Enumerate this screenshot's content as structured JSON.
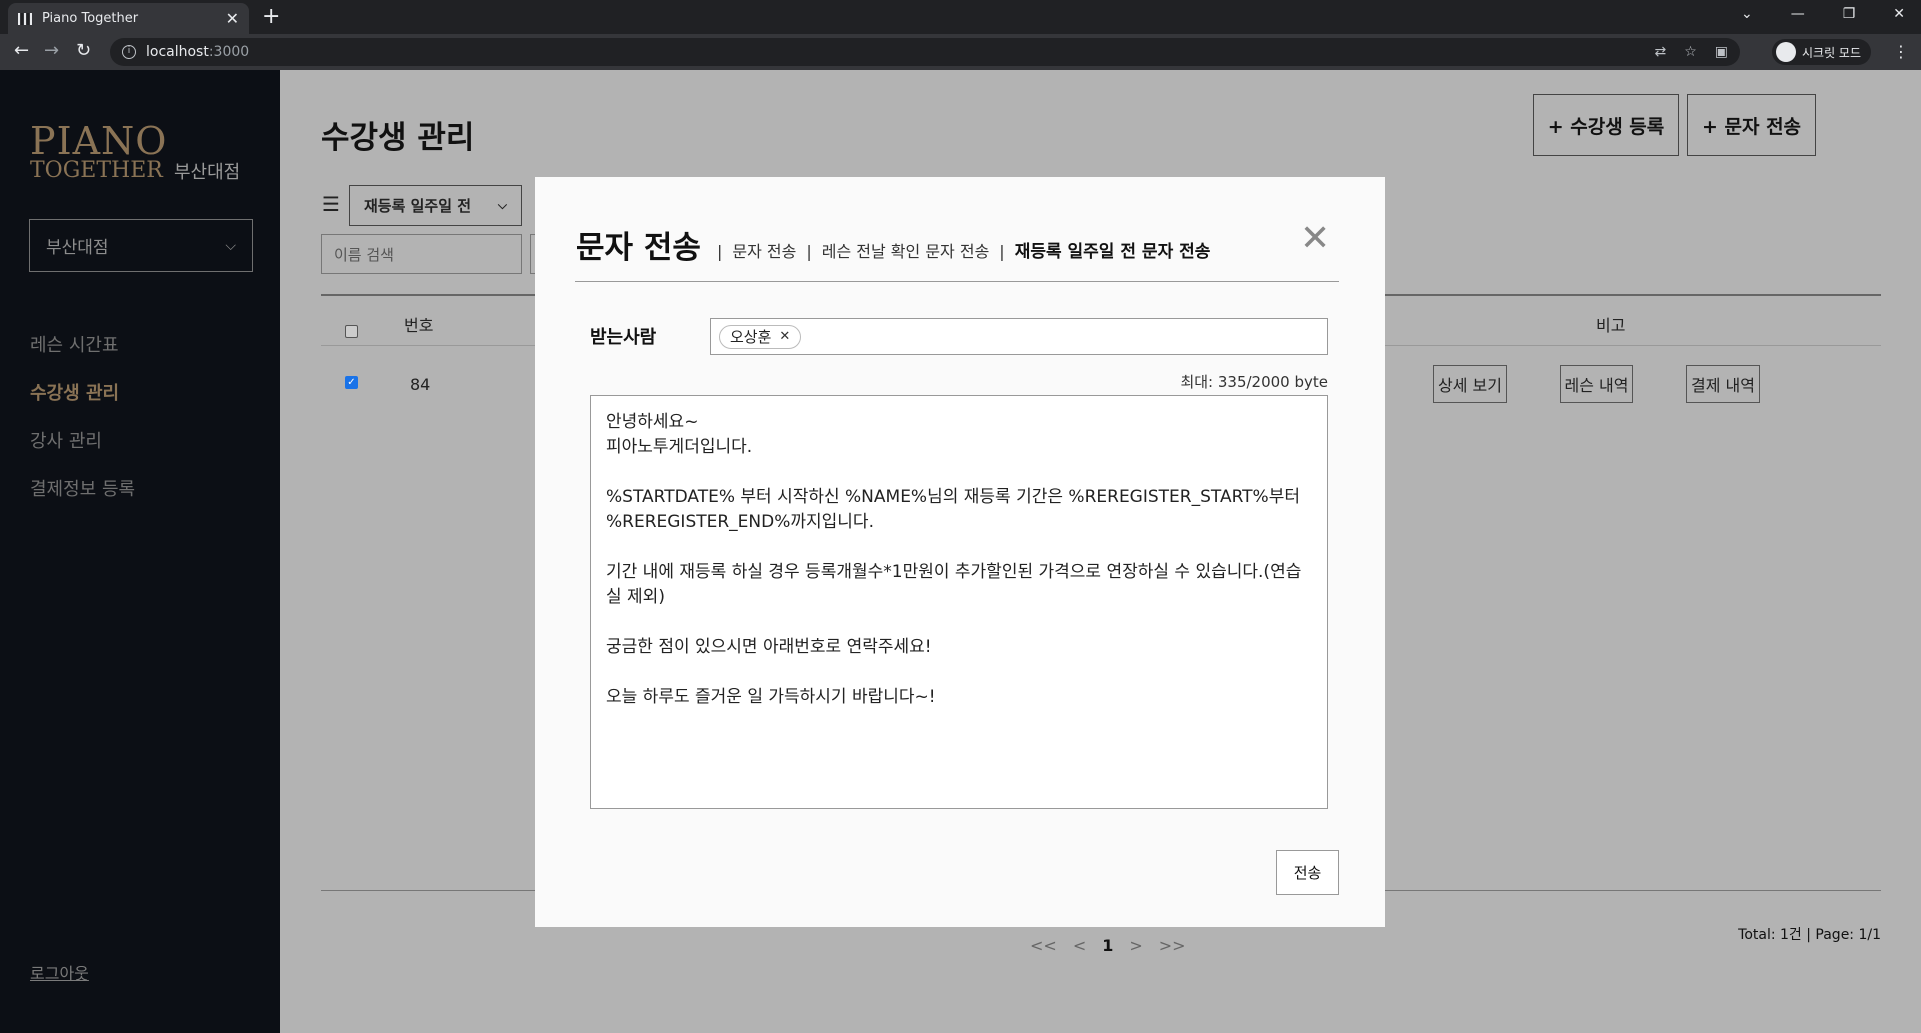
{
  "browser": {
    "tab_title": "Piano Together",
    "url_host": "localhost",
    "url_port": ":3000",
    "profile_label": "시크릿 모드"
  },
  "sidebar": {
    "logo_line1": "PIANO",
    "logo_line2": "TOGETHER",
    "branch_label": "부산대점",
    "branch_select": "부산대점",
    "menu": [
      {
        "label": "레슨 시간표"
      },
      {
        "label": "수강생 관리"
      },
      {
        "label": "강사 관리"
      },
      {
        "label": "결제정보 등록"
      }
    ],
    "active_index": 1,
    "logout": "로그아웃"
  },
  "main": {
    "title": "수강생 관리",
    "register_button": "+ 수강생 등록",
    "sms_button": "+ 문자 전송",
    "filter_value": "재등록 일주일 전",
    "search_placeholder": "이름 검색",
    "columns": {
      "number": "번호",
      "note": "비고"
    },
    "row": {
      "number": "84",
      "detail_button": "상세 보기",
      "lesson_button": "레슨 내역",
      "payment_button": "결제 내역"
    },
    "pager": {
      "first": "<<",
      "prev": "<",
      "current": "1",
      "next": ">",
      "last": ">>"
    },
    "total": "Total: 1건 | Page: 1/1"
  },
  "modal": {
    "title": "문자 전송",
    "tabs": [
      "문자 전송",
      "레슨 전날 확인 문자 전송",
      "재등록 일주일 전 문자 전송"
    ],
    "active_tab": 2,
    "recipient_label": "받는사람",
    "recipient_chip": "오상훈",
    "byte_count": "최대: 335/2000 byte",
    "message": "안녕하세요~\n피아노투게더입니다.\n\n%STARTDATE% 부터 시작하신 %NAME%님의 재등록 기간은 %REREGISTER_START%부터 %REREGISTER_END%까지입니다.\n\n기간 내에 재등록 하실 경우 등록개월수*1만원이 추가할인된 가격으로 연장하실 수 있습니다.(연습실 제외)\n\n궁금한 점이 있으시면 아래번호로 연락주세요!\n\n오늘 하루도 즐거운 일 가득하시기 바랍니다~!",
    "send_button": "전송"
  }
}
